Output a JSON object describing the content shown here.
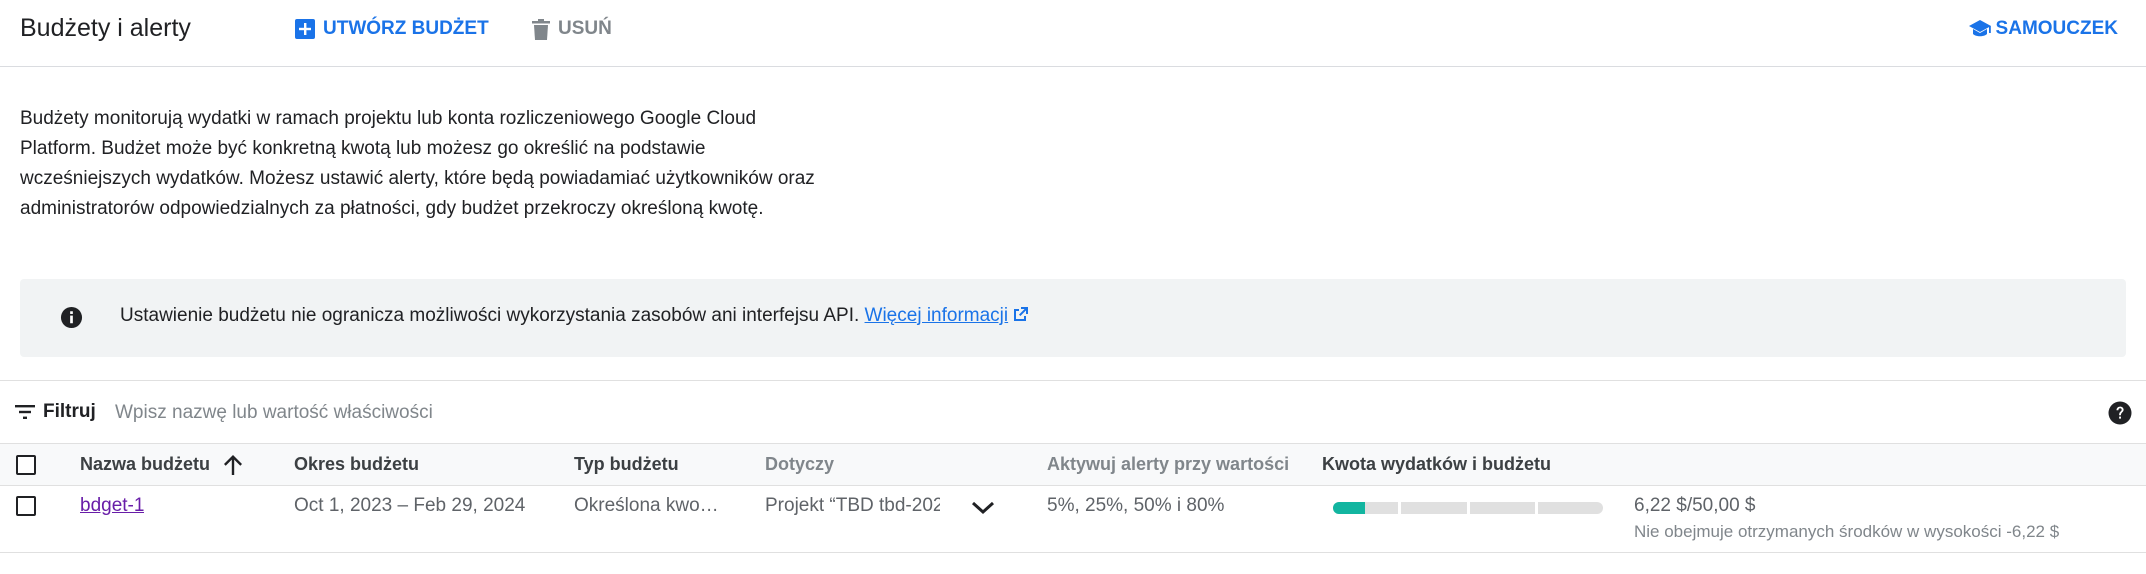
{
  "header": {
    "title": "Budżety i alerty",
    "create_label": "UTWÓRZ BUDŻET",
    "delete_label": "USUŃ",
    "tutorial_label": "SAMOUCZEK"
  },
  "description": "Budżety monitorują wydatki w ramach projektu lub konta rozliczeniowego Google Cloud Platform. Budżet może być konkretną kwotą lub możesz go określić na podstawie wcześniejszych wydatków. Możesz ustawić alerty, które będą powiadamiać użytkowników oraz administratorów odpowiedzialnych za płatności, gdy budżet przekroczy określoną kwotę.",
  "info_banner": {
    "text": "Ustawienie budżetu nie ogranicza możliwości wykorzystania zasobów ani interfejsu API.",
    "link": "Więcej informacji"
  },
  "filter": {
    "label": "Filtruj",
    "placeholder": "Wpisz nazwę lub wartość właściwości"
  },
  "table": {
    "columns": [
      "Nazwa budżetu",
      "Okres budżetu",
      "Typ budżetu",
      "Dotyczy",
      "Aktywuj alerty przy wartości",
      "Kwota wydatków i budżetu"
    ],
    "rows": [
      {
        "name": "bdget-1",
        "period": "Oct 1, 2023 – Feb 29, 2024",
        "type": "Określona kwo…",
        "applies_to": "Projekt “TBD tbd-202",
        "alerts": "5%, 25%, 50% i 80%",
        "spend_fraction": 0.1244,
        "amount": "6,22 $/50,00 $",
        "note": "Nie obejmuje otrzymanych środków w wysokości -6,22 $"
      }
    ]
  },
  "colors": {
    "accent": "#1a73e8",
    "progress_fill": "#12b5a0",
    "visited_link": "#681da8"
  },
  "icons": {
    "create": "add-box-icon",
    "delete": "trash-icon",
    "tutorial": "school-icon",
    "info": "info-icon",
    "external": "external-link-icon",
    "filter": "filter-list-icon",
    "help": "help-icon",
    "sort": "arrow-up-icon",
    "expand": "chevron-down-icon"
  }
}
